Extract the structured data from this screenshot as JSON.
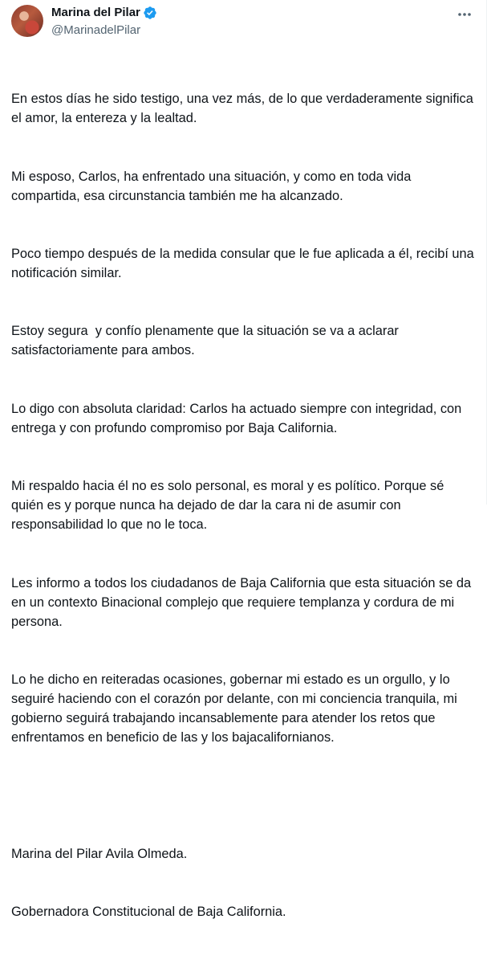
{
  "author": {
    "display_name": "Marina del Pilar",
    "handle": "@MarinadelPilar"
  },
  "icons": {
    "verified": "verified-badge-icon",
    "more": "more-options-icon"
  },
  "colors": {
    "verified_blue": "#1d9bf0",
    "text": "#0f1419",
    "secondary_text": "#536471"
  },
  "tweet": {
    "paragraphs": [
      "En estos días he sido testigo, una vez más, de lo que verdaderamente significa el amor, la entereza y la lealtad.",
      "Mi esposo, Carlos, ha enfrentado una situación, y como en toda vida compartida, esa circunstancia también me ha alcanzado.",
      "Poco tiempo después de la medida consular que le fue aplicada a él, recibí una notificación similar.",
      "Estoy segura  y confío plenamente que la situación se va a aclarar satisfactoriamente para ambos.",
      "Lo digo con absoluta claridad: Carlos ha actuado siempre con integridad, con entrega y con profundo compromiso por Baja California.",
      "Mi respaldo hacia él no es solo personal, es moral y es político. Porque sé quién es y porque nunca ha dejado de dar la cara ni de asumir con responsabilidad lo que no le toca.",
      "Les informo a todos los ciudadanos de Baja California que esta situación se da en un contexto Binacional complejo que requiere templanza y cordura de mi persona.",
      "Lo he dicho en reiteradas ocasiones, gobernar mi estado es un orgullo, y lo seguiré haciendo con el corazón por delante, con mi conciencia tranquila, mi gobierno seguirá trabajando incansablemente para atender los retos que enfrentamos en beneficio de las y los bajacalifornianos."
    ],
    "signature_name": "Marina del Pilar Avila Olmeda.",
    "signature_title": "Gobernadora Constitucional de Baja California."
  }
}
